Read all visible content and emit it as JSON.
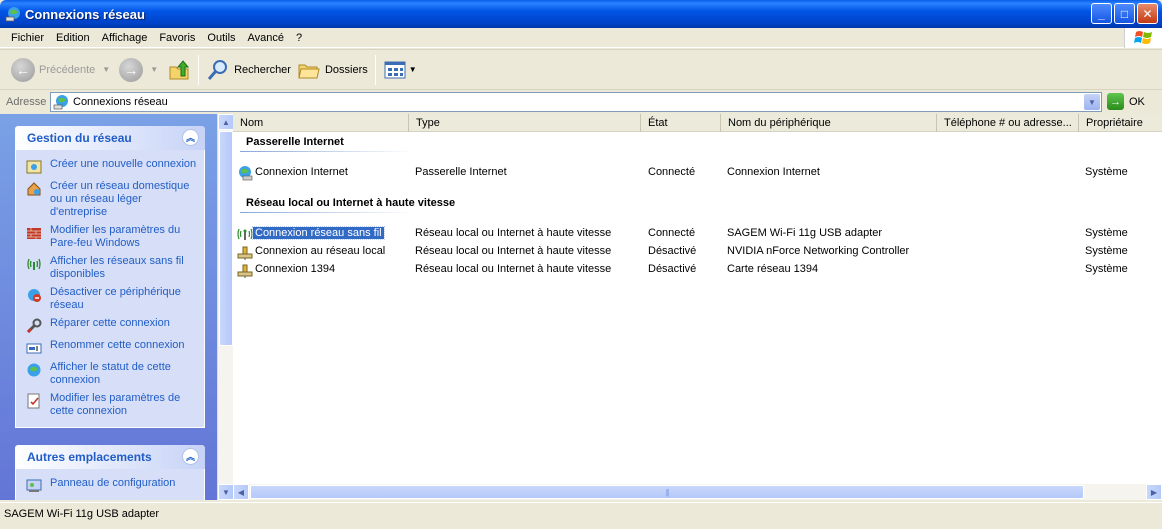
{
  "window": {
    "title": "Connexions réseau",
    "buttons": {
      "minimize": "_",
      "maximize": "□",
      "close": "✕"
    }
  },
  "menu": [
    "Fichier",
    "Edition",
    "Affichage",
    "Favoris",
    "Outils",
    "Avancé",
    "?"
  ],
  "toolbar": {
    "back_label": "Précédente",
    "search_label": "Rechercher",
    "folders_label": "Dossiers"
  },
  "address": {
    "label": "Adresse",
    "value": "Connexions réseau",
    "go_label": "OK"
  },
  "taskpane": {
    "network_tasks": {
      "title": "Gestion du réseau",
      "items": [
        {
          "label": "Créer une nouvelle connexion",
          "icon": "new-connection-icon"
        },
        {
          "label": "Créer un réseau domestique ou un réseau léger d'entreprise",
          "icon": "home-network-icon"
        },
        {
          "label": "Modifier les paramètres du Pare-feu Windows",
          "icon": "firewall-icon"
        },
        {
          "label": "Afficher les réseaux sans fil disponibles",
          "icon": "wireless-icon"
        },
        {
          "label": "Désactiver ce périphérique réseau",
          "icon": "disable-device-icon"
        },
        {
          "label": "Réparer cette connexion",
          "icon": "repair-icon"
        },
        {
          "label": "Renommer cette connexion",
          "icon": "rename-icon"
        },
        {
          "label": "Afficher le statut de cette connexion",
          "icon": "status-icon"
        },
        {
          "label": "Modifier les paramètres de cette connexion",
          "icon": "settings-icon"
        }
      ]
    },
    "other_places": {
      "title": "Autres emplacements",
      "items": [
        {
          "label": "Panneau de configuration",
          "icon": "control-panel-icon"
        }
      ]
    }
  },
  "listview": {
    "columns": [
      "Nom",
      "Type",
      "État",
      "Nom du périphérique",
      "Téléphone # ou adresse...",
      "Propriétaire"
    ],
    "groups": [
      {
        "title": "Passerelle Internet",
        "rows": [
          {
            "name": "Connexion Internet",
            "type": "Passerelle Internet",
            "state": "Connecté",
            "device": "Connexion Internet",
            "phone": "",
            "owner": "Système",
            "icon": "internet-gateway-icon"
          }
        ]
      },
      {
        "title": "Réseau local ou Internet à haute vitesse",
        "rows": [
          {
            "name": "Connexion réseau sans fil",
            "type": "Réseau local ou Internet à haute vitesse",
            "state": "Connecté",
            "device": "SAGEM Wi-Fi 11g USB adapter",
            "phone": "",
            "owner": "Système",
            "icon": "wireless-connection-icon",
            "selected": true
          },
          {
            "name": "Connexion au réseau local",
            "type": "Réseau local ou Internet à haute vitesse",
            "state": "Désactivé",
            "device": "NVIDIA nForce Networking Controller",
            "phone": "",
            "owner": "Système",
            "icon": "lan-connection-icon"
          },
          {
            "name": "Connexion 1394",
            "type": "Réseau local ou Internet à haute vitesse",
            "state": "Désactivé",
            "device": "Carte réseau 1394",
            "phone": "",
            "owner": "Système",
            "icon": "lan-connection-icon"
          }
        ]
      }
    ]
  },
  "status": {
    "text": "SAGEM Wi-Fi 11g USB adapter"
  },
  "colors": {
    "titlebar": "#0055e5",
    "link": "#215dc6",
    "selection": "#316ac5"
  }
}
